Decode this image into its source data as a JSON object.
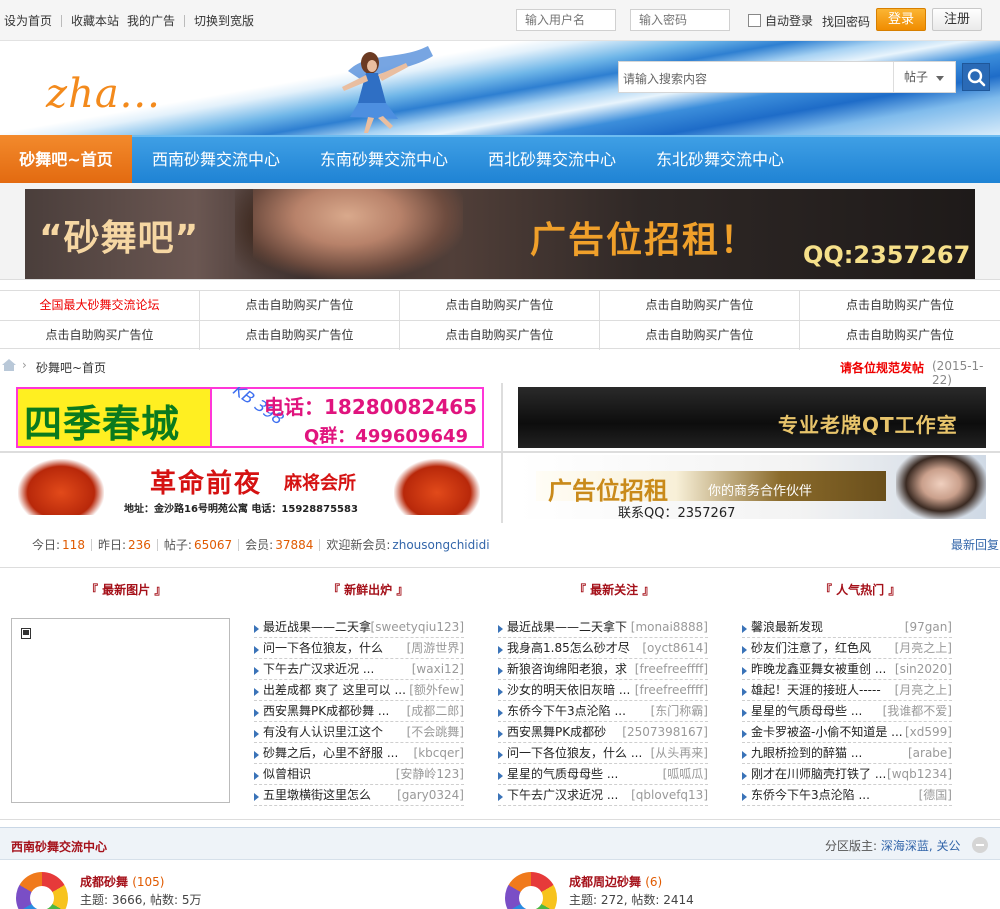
{
  "topbar": {
    "links": [
      "设为首页",
      "收藏本站",
      "我的广告",
      "切换到宽版"
    ],
    "username_placeholder": "输入用户名",
    "password_placeholder": "输入密码",
    "remember_label": "自动登录",
    "findpw_label": "找回密码",
    "login_label": "登录",
    "register_label": "注册"
  },
  "header": {
    "logo_text": "zha...",
    "search_placeholder": "请输入搜索内容",
    "search_type": "帖子"
  },
  "nav": {
    "home": "砂舞吧~首页",
    "items": [
      "西南砂舞交流中心",
      "东南砂舞交流中心",
      "西北砂舞交流中心",
      "东北砂舞交流中心"
    ]
  },
  "banner": {
    "brand": "“砂舞吧”",
    "slogan": "广告位招租！",
    "qq": "QQ:2357267"
  },
  "linkgrid": {
    "row1": [
      "全国最大砂舞交流论坛",
      "点击自助购买广告位",
      "点击自助购买广告位",
      "点击自助购买广告位",
      "点击自助购买广告位"
    ],
    "row2": [
      "点击自助购买广告位",
      "点击自助购买广告位",
      "点击自助购买广告位",
      "点击自助购买广告位",
      "点击自助购买广告位"
    ]
  },
  "breadcrumb": {
    "current": "砂舞吧~首页",
    "notice": "请各位规范发帖",
    "date": "(2015-1-22)"
  },
  "ads": {
    "ad1": {
      "name": "四季春城",
      "code": "KB 398",
      "phone": "电话：18280082465",
      "qq": "Q群：499609649"
    },
    "ad2": {
      "text": "专业老牌QT工作室"
    },
    "ad3": {
      "name": "革命前夜",
      "sub": "麻将会所",
      "address": "地址：金沙路16号明苑公寓 电话：15928875583"
    },
    "ad4": {
      "title": "广告位招租",
      "sub": "你的商务合作伙伴",
      "qq": "联系QQ：2357267"
    }
  },
  "stats": {
    "today_label": "今日:",
    "today": "118",
    "yesterday_label": "昨日:",
    "yesterday": "236",
    "posts_label": "帖子:",
    "posts": "65067",
    "members_label": "会员:",
    "members": "37884",
    "welcome_label": "欢迎新会员:",
    "newest_member": "zhousongchididi",
    "latest_reply": "最新回复"
  },
  "panels": {
    "headers": [
      "『 最新图片 』",
      "『 新鲜出炉 』",
      "『 最新关注 』",
      "『 人气热门 』"
    ],
    "fresh": [
      {
        "t": "最近战果——二天拿",
        "u": "[sweetyqiu123]"
      },
      {
        "t": "问一下各位狼友，什么",
        "u": "[周游世界]"
      },
      {
        "t": "下午去广汉求近况 ...",
        "u": "[waxi12]"
      },
      {
        "t": "出差成都 爽了 这里可以 ...",
        "u": "[额外few]"
      },
      {
        "t": "西安黑舞PK成都砂舞 ...",
        "u": "[成都二郎]"
      },
      {
        "t": "有没有人认识里江这个",
        "u": "[不会跳舞]"
      },
      {
        "t": "砂舞之后，心里不舒服 ...",
        "u": "[kbcqer]"
      },
      {
        "t": "似曾相识",
        "u": "[安静岭123]"
      },
      {
        "t": "五里墩横街这里怎么",
        "u": "[gary0324]"
      }
    ],
    "follow": [
      {
        "t": "最近战果——二天拿下",
        "u": "[monai8888]"
      },
      {
        "t": "我身高1.85怎么砂才尽",
        "u": "[oyct8614]"
      },
      {
        "t": "新狼咨询绵阳老狼，求",
        "u": "[freefreeffff]"
      },
      {
        "t": "沙女的明天依旧灰暗 ...",
        "u": "[freefreeffff]"
      },
      {
        "t": "东侨今下午3点沦陷 ...",
        "u": "[东门称霸]"
      },
      {
        "t": "西安黑舞PK成都砂",
        "u": "[2507398167]"
      },
      {
        "t": "问一下各位狼友，什么 ...",
        "u": "[从头再来]"
      },
      {
        "t": "星星的气质母母些 ...",
        "u": "[呱呱瓜]"
      },
      {
        "t": "下午去广汉求近况 ...",
        "u": "[qblovefq13]"
      }
    ],
    "hot": [
      {
        "t": "馨浪最新发现",
        "u": "[97gan]"
      },
      {
        "t": "砂友们注意了，红色风",
        "u": "[月亮之上]"
      },
      {
        "t": "昨晚龙鑫亚舞女被重创 ...",
        "u": "[sin2020]"
      },
      {
        "t": "雄起！天涯的接班人-----",
        "u": "[月亮之上]"
      },
      {
        "t": "星星的气质母母些 ...",
        "u": "[我谁都不爱]"
      },
      {
        "t": "金卡罗被盗-小偷不知道是 ...",
        "u": "[xd599]"
      },
      {
        "t": "九眼桥捡到的醉猫 ...",
        "u": "[arabe]"
      },
      {
        "t": "刚才在川师脑壳打铁了 ...",
        "u": "[wqb1234]"
      },
      {
        "t": "东侨今下午3点沦陷 ...",
        "u": "[德国]"
      }
    ]
  },
  "section": {
    "title": "西南砂舞交流中心",
    "moderators_label": "分区版主:",
    "moderators": "深海深蓝, 关公",
    "forums": [
      {
        "name": "成都砂舞",
        "count": "(105)",
        "meta": "主题: 3666, 帖数: 5万"
      },
      {
        "name": "成都周边砂舞",
        "count": "(6)",
        "meta": "主题: 272, 帖数: 2414"
      }
    ]
  },
  "colors": {
    "accent_orange": "#e2690f",
    "nav_blue": "#1f83d4",
    "title_red": "#a5111a",
    "link_blue": "#3366aa"
  }
}
